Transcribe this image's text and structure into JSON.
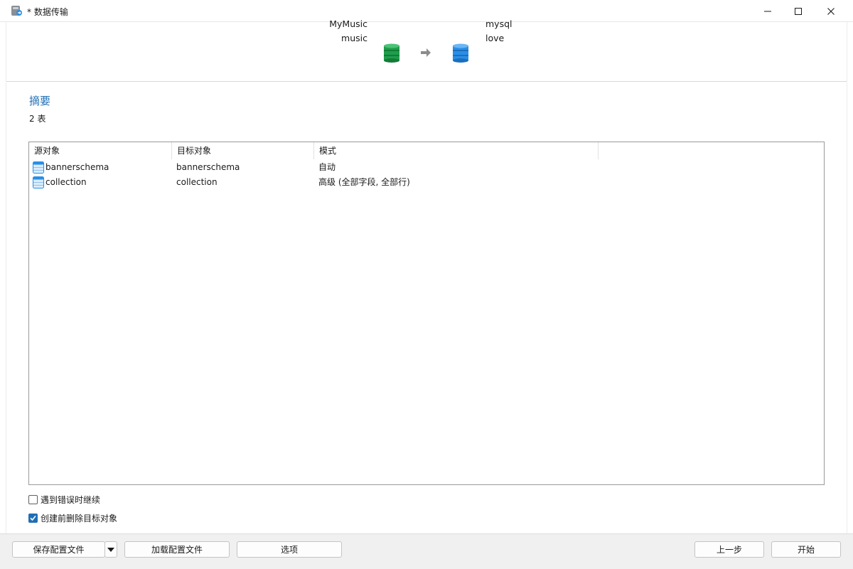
{
  "window": {
    "title": "* 数据传输",
    "controls": [
      "minimize-icon",
      "maximize-icon",
      "close-icon"
    ]
  },
  "header": {
    "source": {
      "connection": "MyMusic",
      "database": "music",
      "icon": "database-green-icon"
    },
    "arrow_icon": "arrow-right-icon",
    "target": {
      "connection": "mysql",
      "database": "love",
      "icon": "database-blue-icon"
    }
  },
  "summary": {
    "title": "摘要",
    "count": "2 表"
  },
  "table": {
    "columns": [
      "源对象",
      "目标对象",
      "模式"
    ],
    "rows": [
      {
        "source": "bannerschema",
        "target": "bannerschema",
        "mode": "自动"
      },
      {
        "source": "collection",
        "target": "collection",
        "mode": "高级 (全部字段, 全部行)"
      }
    ]
  },
  "options": {
    "continue_on_error": {
      "label": "遇到错误时继续",
      "checked": false
    },
    "drop_target_before_create": {
      "label": "创建前删除目标对象",
      "checked": true
    }
  },
  "footer": {
    "save_profile": "保存配置文件",
    "load_profile": "加载配置文件",
    "options": "选项",
    "back": "上一步",
    "start": "开始"
  },
  "colors": {
    "accent": "#1f6fb5",
    "source_db": "#1e9e4a",
    "target_db": "#2b8ee6"
  }
}
